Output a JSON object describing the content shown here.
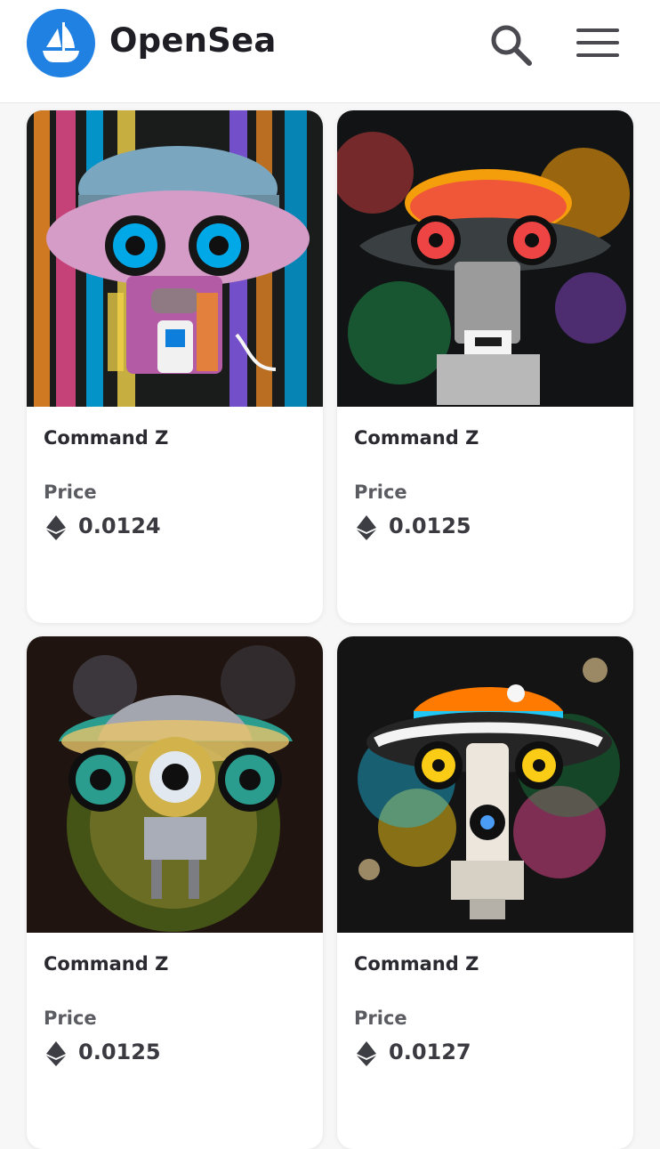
{
  "header": {
    "brand": "OpenSea",
    "logo_icon": "opensea-ship-logo",
    "search_icon": "search-icon",
    "menu_icon": "hamburger-menu-icon",
    "accent": "#2081e2"
  },
  "cards": [
    {
      "title": "Command Z",
      "price_label": "Price",
      "price": "0.0124",
      "currency_icon": "ethereum-icon",
      "palette": [
        "#1a1c1b",
        "#8b5cf6",
        "#00a8e8",
        "#f08a24",
        "#f3d34a",
        "#ff4f9a"
      ]
    },
    {
      "title": "Command Z",
      "price_label": "Price",
      "price": "0.0125",
      "currency_icon": "ethereum-icon",
      "palette": [
        "#111315",
        "#2dd4bf",
        "#ef4444",
        "#f59e0b",
        "#a855f7",
        "#22c55e"
      ]
    },
    {
      "title": "Command Z",
      "price_label": "Price",
      "price": "0.0125",
      "currency_icon": "ethereum-icon",
      "palette": [
        "#1f140f",
        "#7cc1d6",
        "#d1b24b",
        "#8ac926",
        "#2a9d8f",
        "#e9c46a"
      ]
    },
    {
      "title": "Command Z",
      "price_label": "Price",
      "price": "0.0127",
      "currency_icon": "ethereum-icon",
      "palette": [
        "#141414",
        "#ff7a00",
        "#ff4d9d",
        "#21c8f6",
        "#facc15",
        "#16a34a"
      ]
    }
  ]
}
